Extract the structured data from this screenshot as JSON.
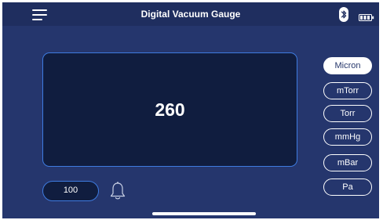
{
  "header": {
    "title": "Digital Vacuum Gauge",
    "menu_icon": "hamburger-menu-icon",
    "bluetooth_icon": "bluetooth-icon",
    "battery_icon": "battery-icon"
  },
  "display": {
    "reading": "260"
  },
  "units": {
    "selected": "Micron",
    "options": [
      {
        "label": "Micron"
      },
      {
        "label": "mTorr"
      },
      {
        "label": "Torr"
      },
      {
        "label": "mmHg"
      },
      {
        "label": "mBar"
      },
      {
        "label": "Pa"
      }
    ]
  },
  "alarm": {
    "setpoint": "100",
    "icon": "bell-icon"
  },
  "colors": {
    "background": "#25366d",
    "topbar": "#1f2e5f",
    "panel": "#101d3f",
    "accent_border": "#3e7be0",
    "text": "#ffffff"
  }
}
